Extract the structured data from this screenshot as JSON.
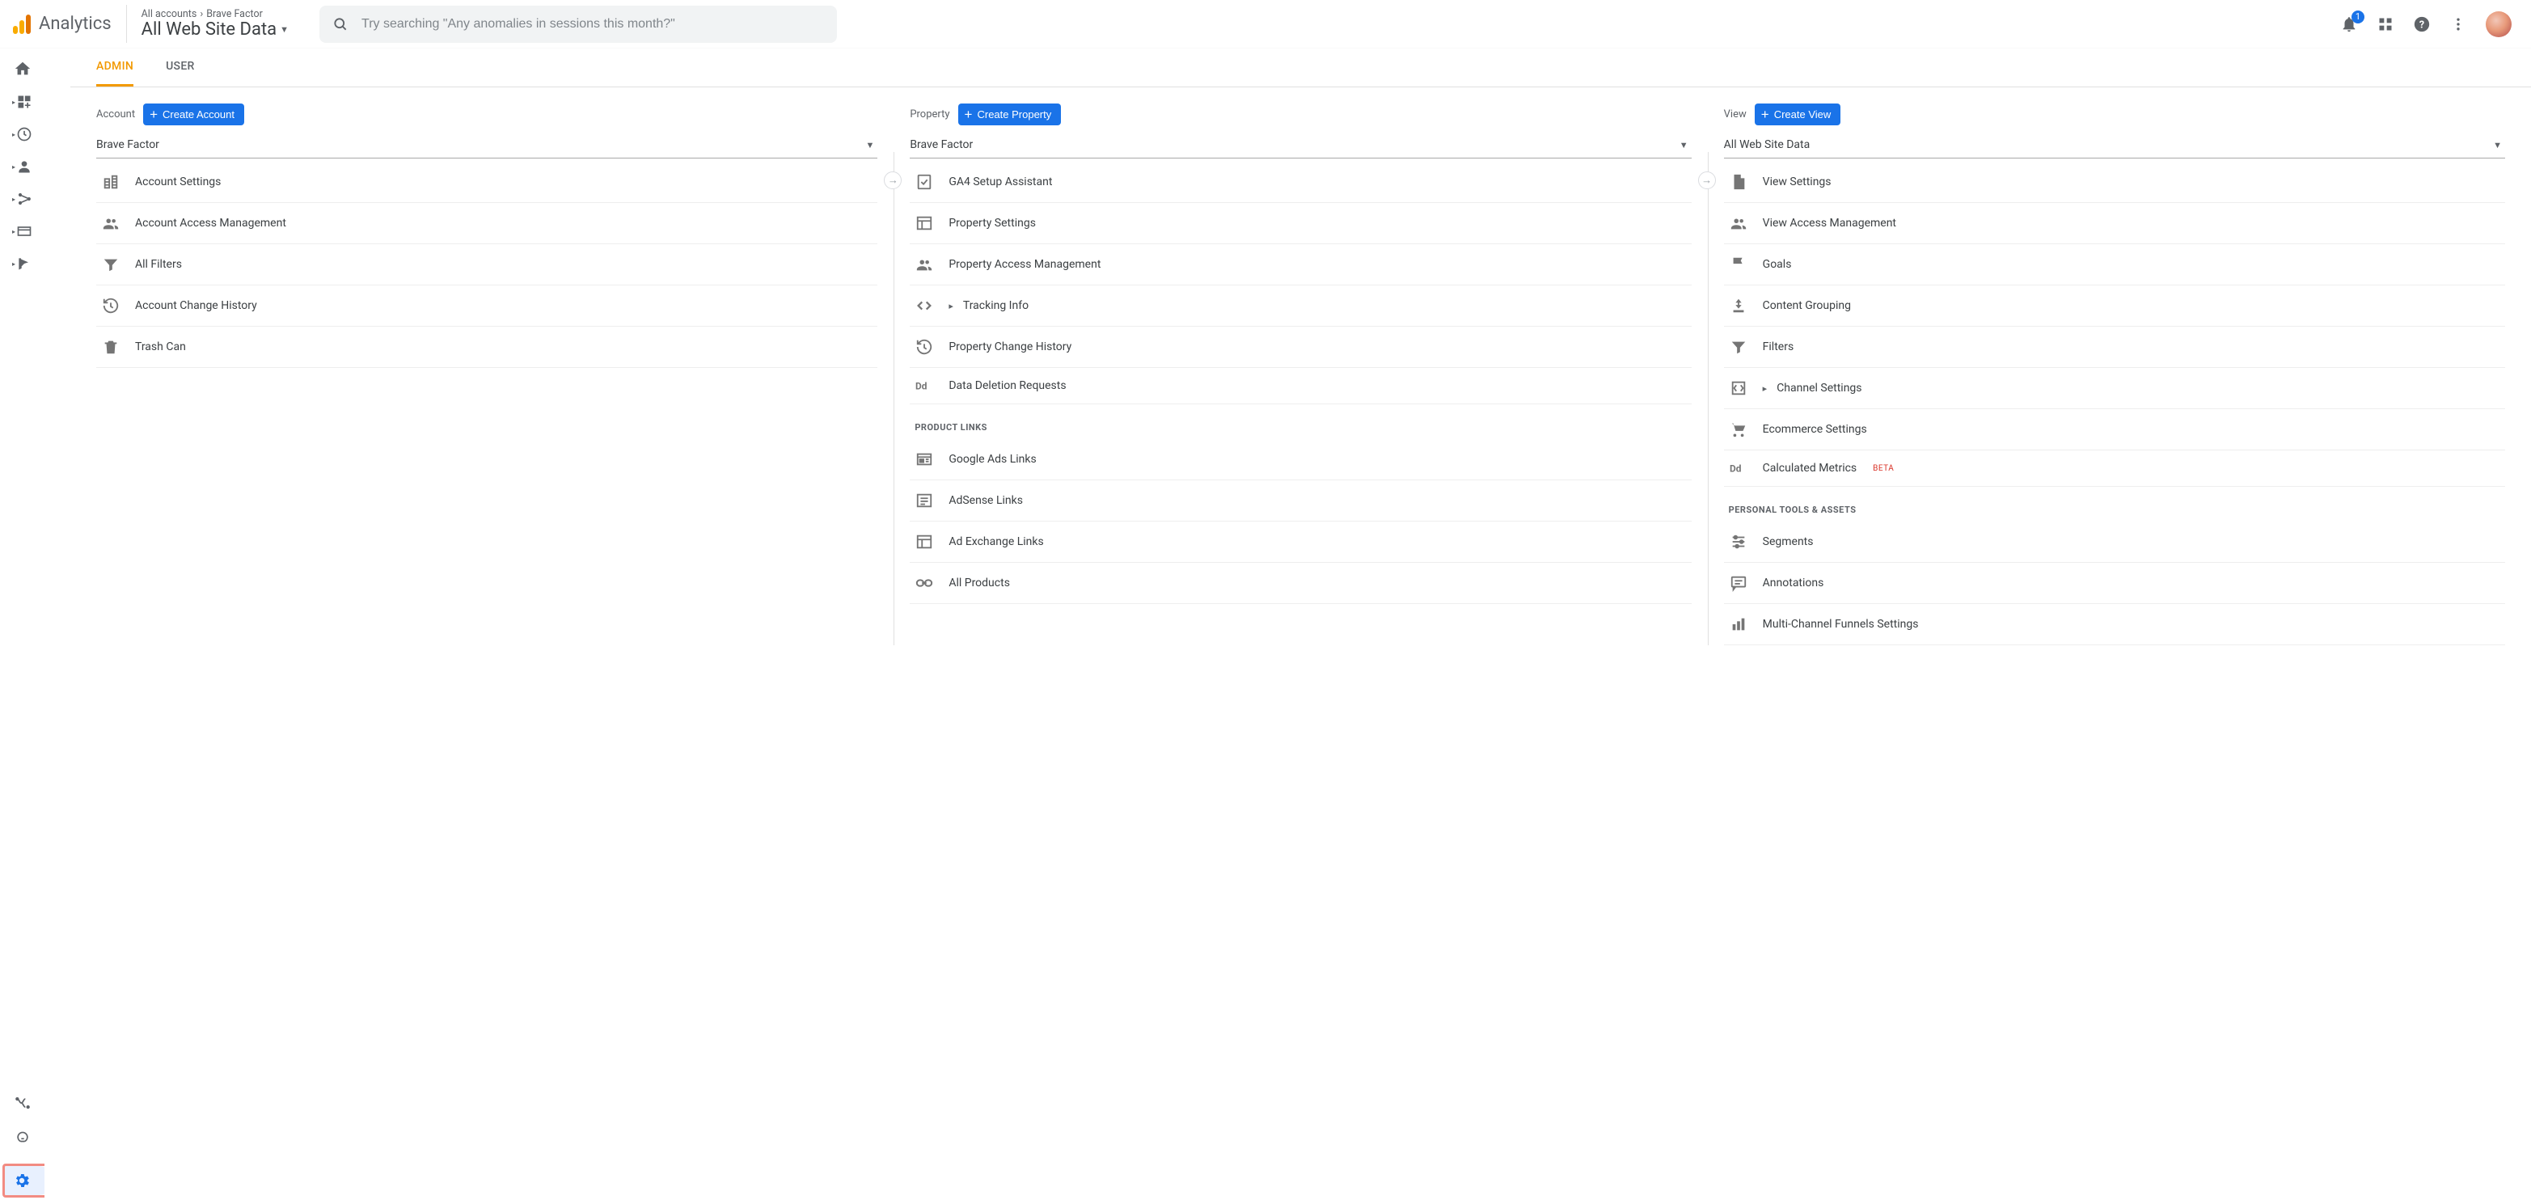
{
  "header": {
    "product": "Analytics",
    "breadcrumb_root": "All accounts",
    "breadcrumb_account": "Brave Factor",
    "view_name": "All Web Site Data",
    "search_placeholder": "Try searching \"Any anomalies in sessions this month?\"",
    "notification_count": "1"
  },
  "tabs": {
    "admin": "ADMIN",
    "user": "USER"
  },
  "tooltip": {
    "admin": "Admin"
  },
  "columns": {
    "account": {
      "label": "Account",
      "create": "Create Account",
      "selected": "Brave Factor",
      "items": [
        {
          "icon": "building",
          "label": "Account Settings"
        },
        {
          "icon": "people",
          "label": "Account Access Management"
        },
        {
          "icon": "filter",
          "label": "All Filters"
        },
        {
          "icon": "history",
          "label": "Account Change History"
        },
        {
          "icon": "trash",
          "label": "Trash Can"
        }
      ]
    },
    "property": {
      "label": "Property",
      "create": "Create Property",
      "selected": "Brave Factor",
      "items": [
        {
          "icon": "check-doc",
          "label": "GA4 Setup Assistant"
        },
        {
          "icon": "panel",
          "label": "Property Settings"
        },
        {
          "icon": "people",
          "label": "Property Access Management"
        },
        {
          "icon": "code",
          "label": "Tracking Info",
          "expandable": true
        },
        {
          "icon": "history",
          "label": "Property Change History"
        },
        {
          "icon": "dd",
          "label": "Data Deletion Requests"
        }
      ],
      "section_product_links": "PRODUCT LINKS",
      "product_links": [
        {
          "icon": "newspaper",
          "label": "Google Ads Links"
        },
        {
          "icon": "list-box",
          "label": "AdSense Links"
        },
        {
          "icon": "panel",
          "label": "Ad Exchange Links"
        },
        {
          "icon": "link",
          "label": "All Products"
        }
      ]
    },
    "view": {
      "label": "View",
      "create": "Create View",
      "selected": "All Web Site Data",
      "items": [
        {
          "icon": "doc",
          "label": "View Settings"
        },
        {
          "icon": "people",
          "label": "View Access Management"
        },
        {
          "icon": "flag",
          "label": "Goals"
        },
        {
          "icon": "group",
          "label": "Content Grouping"
        },
        {
          "icon": "filter",
          "label": "Filters"
        },
        {
          "icon": "channel",
          "label": "Channel Settings",
          "expandable": true
        },
        {
          "icon": "cart",
          "label": "Ecommerce Settings"
        },
        {
          "icon": "dd",
          "label": "Calculated Metrics",
          "beta": "BETA"
        }
      ],
      "section_personal": "PERSONAL TOOLS & ASSETS",
      "personal": [
        {
          "icon": "segments",
          "label": "Segments"
        },
        {
          "icon": "chat",
          "label": "Annotations"
        },
        {
          "icon": "bars",
          "label": "Multi-Channel Funnels Settings"
        }
      ]
    }
  }
}
